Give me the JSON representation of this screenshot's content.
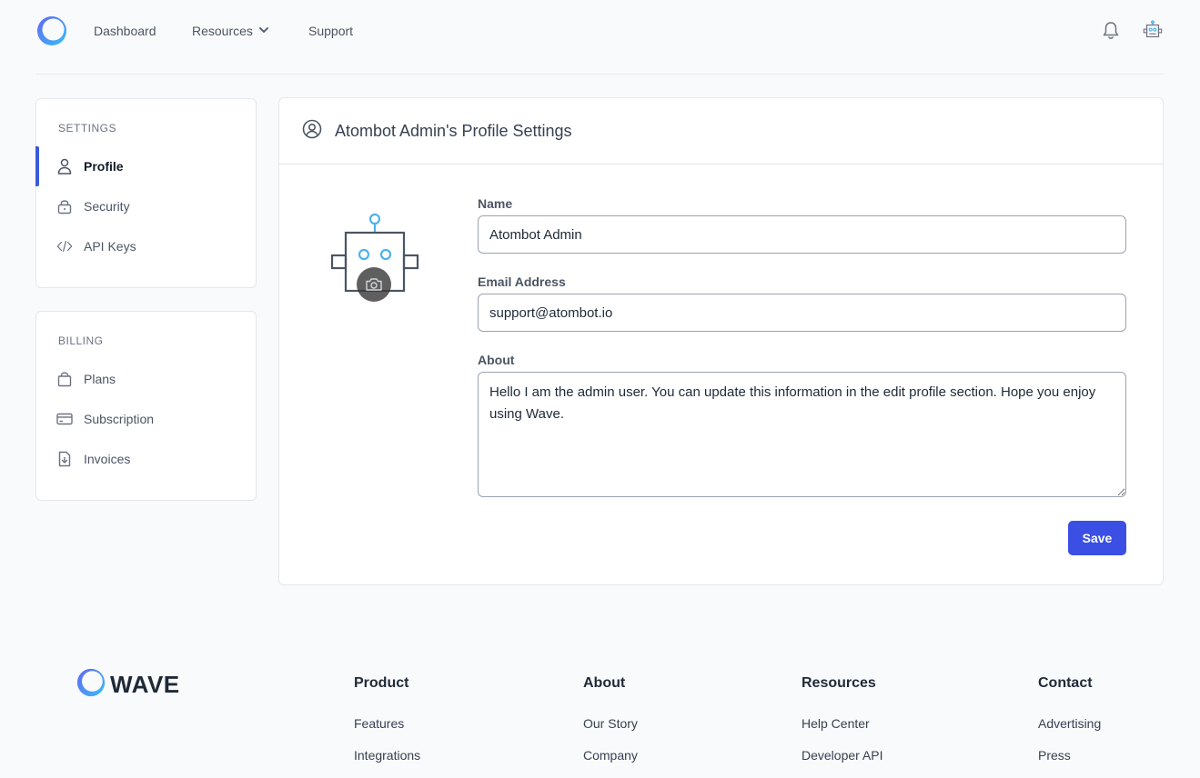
{
  "header": {
    "nav": [
      {
        "label": "Dashboard"
      },
      {
        "label": "Resources"
      },
      {
        "label": "Support"
      }
    ]
  },
  "sidebar": {
    "settings": {
      "heading": "SETTINGS",
      "items": [
        {
          "label": "Profile",
          "icon": "user-icon",
          "active": true
        },
        {
          "label": "Security",
          "icon": "lock-icon"
        },
        {
          "label": "API Keys",
          "icon": "code-icon"
        }
      ]
    },
    "billing": {
      "heading": "BILLING",
      "items": [
        {
          "label": "Plans",
          "icon": "bag-icon"
        },
        {
          "label": "Subscription",
          "icon": "credit-card-icon"
        },
        {
          "label": "Invoices",
          "icon": "document-download-icon"
        }
      ]
    }
  },
  "profile": {
    "title": "Atombot Admin's Profile Settings",
    "name_label": "Name",
    "name_value": "Atombot Admin",
    "email_label": "Email Address",
    "email_value": "support@atombot.io",
    "about_label": "About",
    "about_value": "Hello I am the admin user. You can update this information in the edit profile section. Hope you enjoy using Wave.",
    "save_label": "Save"
  },
  "footer": {
    "brand": "WAVE",
    "columns": [
      {
        "title": "Product",
        "links": [
          "Features",
          "Integrations"
        ]
      },
      {
        "title": "About",
        "links": [
          "Our Story",
          "Company"
        ]
      },
      {
        "title": "Resources",
        "links": [
          "Help Center",
          "Developer API"
        ]
      },
      {
        "title": "Contact",
        "links": [
          "Advertising",
          "Press"
        ]
      }
    ]
  },
  "colors": {
    "accent": "#3b4fe4",
    "active_indicator": "#3b5bdb",
    "robot_accent": "#4fb3e8"
  }
}
